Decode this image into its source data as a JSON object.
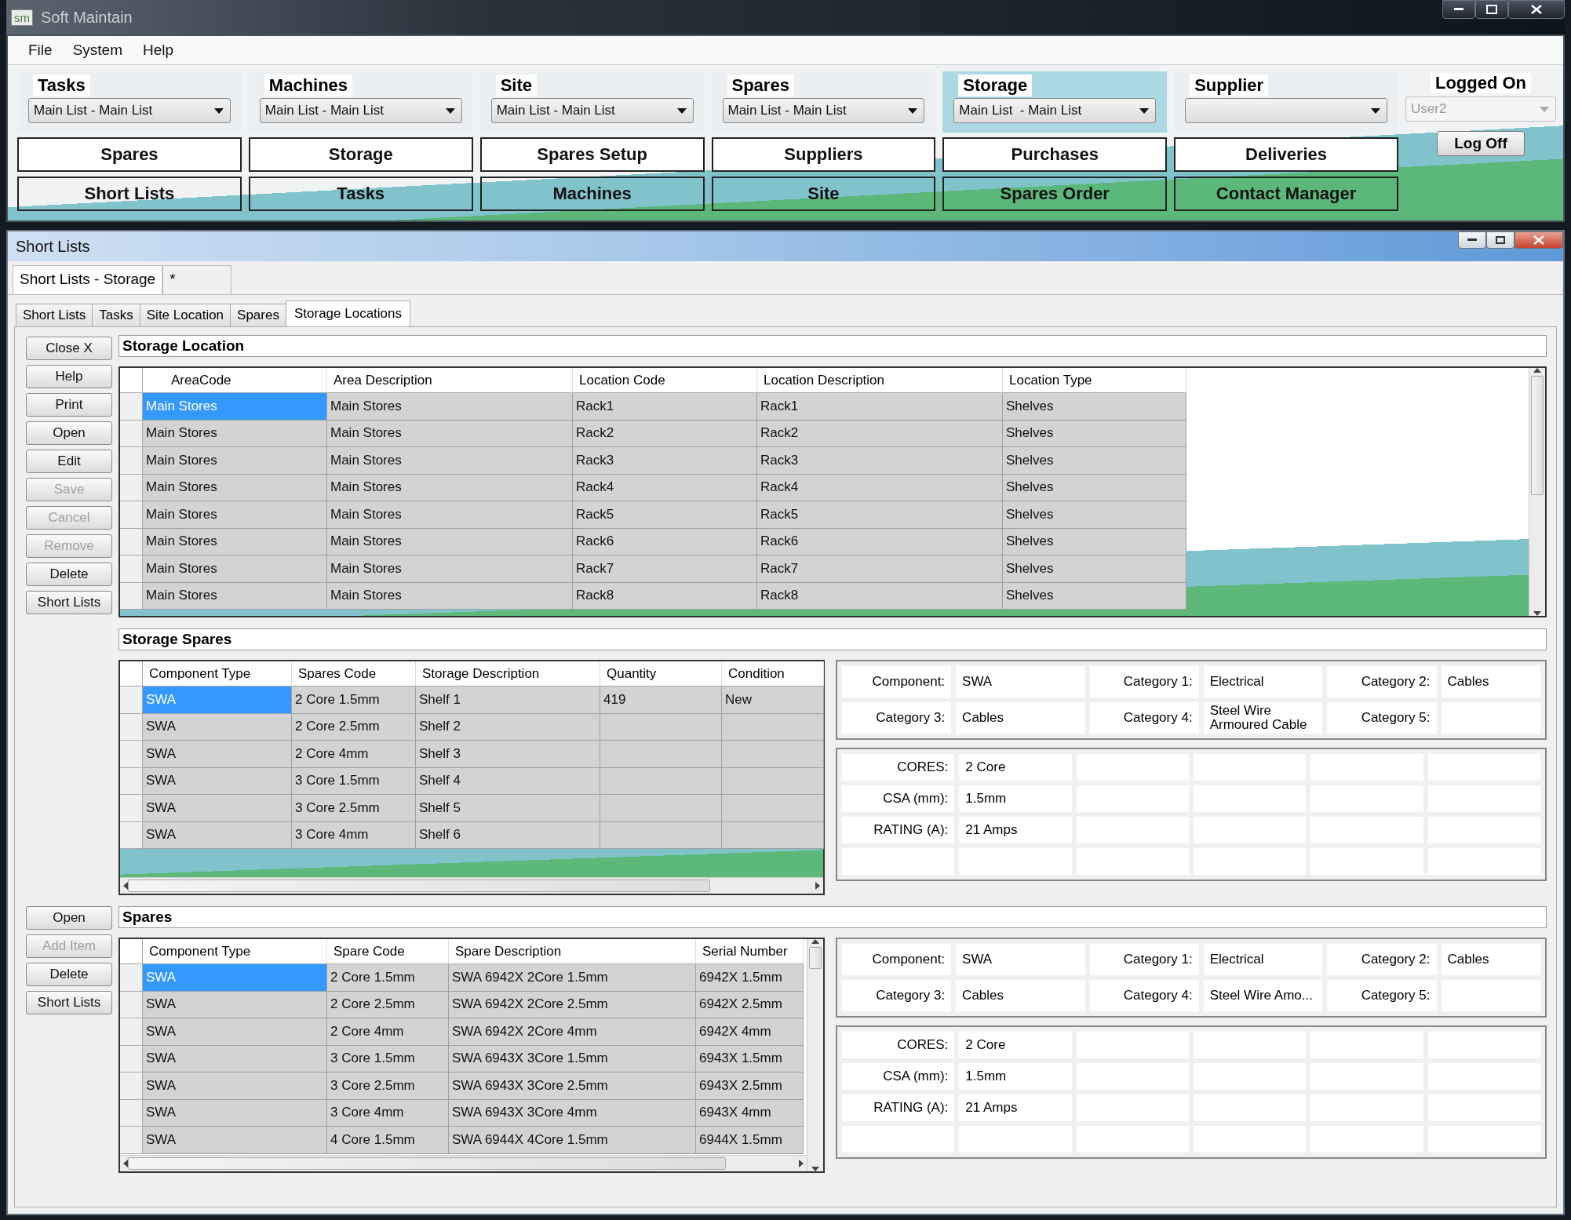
{
  "window": {
    "title": "Soft Maintain",
    "logo": "sm"
  },
  "menu": [
    "File",
    "System",
    "Help"
  ],
  "selectors": [
    {
      "label": "Tasks",
      "value": "Main List - Main List",
      "selected": false
    },
    {
      "label": "Machines",
      "value": "Main List - Main List",
      "selected": false
    },
    {
      "label": "Site",
      "value": "Main List - Main List",
      "selected": false
    },
    {
      "label": "Spares",
      "value": "Main List - Main List",
      "selected": false
    },
    {
      "label": "Storage",
      "value": "Main List  - Main List",
      "selected": true
    },
    {
      "label": "Supplier",
      "selected": false
    }
  ],
  "login": {
    "label": "Logged On",
    "user": "User2",
    "button": "Log Off"
  },
  "nav_rows": [
    [
      "Spares",
      "Storage",
      "Spares Setup",
      "Suppliers",
      "Purchases",
      "Deliveries"
    ],
    [
      "Short Lists",
      "Tasks",
      "Machines",
      "Site",
      "Spares Order",
      "Contact Manager"
    ]
  ],
  "child_window": {
    "title": "Short Lists"
  },
  "doc_tabs": [
    {
      "label": "Short Lists - Storage",
      "selected": true
    },
    {
      "label": "*",
      "selected": false
    }
  ],
  "tabs": [
    {
      "label": "Short Lists",
      "selected": false
    },
    {
      "label": "Tasks",
      "selected": false
    },
    {
      "label": "Site Location",
      "selected": false
    },
    {
      "label": "Spares",
      "selected": false
    },
    {
      "label": "Storage Locations",
      "selected": true
    }
  ],
  "side_buttons": [
    {
      "label": "Close X",
      "disabled": false
    },
    {
      "label": "Help",
      "disabled": false
    },
    {
      "label": "Print",
      "disabled": false
    },
    {
      "label": "Open",
      "disabled": false
    },
    {
      "label": "Edit",
      "disabled": false
    },
    {
      "label": "Save",
      "disabled": true
    },
    {
      "label": "Cancel",
      "disabled": true
    },
    {
      "label": "Remove",
      "disabled": true
    },
    {
      "label": "Delete",
      "disabled": false
    },
    {
      "label": "Short Lists",
      "disabled": false
    }
  ],
  "storage_location": {
    "title": "Storage Location",
    "columns": [
      "AreaCode",
      "Area Description",
      "Location Code",
      "Location Description",
      "Location Type"
    ],
    "rows": [
      {
        "cells": [
          "Main Stores",
          "Main Stores",
          "Rack1",
          "Rack1",
          "Shelves"
        ],
        "selected": true
      },
      {
        "cells": [
          "Main Stores",
          "Main Stores",
          "Rack2",
          "Rack2",
          "Shelves"
        ],
        "selected": false
      },
      {
        "cells": [
          "Main Stores",
          "Main Stores",
          "Rack3",
          "Rack3",
          "Shelves"
        ],
        "selected": false
      },
      {
        "cells": [
          "Main Stores",
          "Main Stores",
          "Rack4",
          "Rack4",
          "Shelves"
        ],
        "selected": false
      },
      {
        "cells": [
          "Main Stores",
          "Main Stores",
          "Rack5",
          "Rack5",
          "Shelves"
        ],
        "selected": false
      },
      {
        "cells": [
          "Main Stores",
          "Main Stores",
          "Rack6",
          "Rack6",
          "Shelves"
        ],
        "selected": false
      },
      {
        "cells": [
          "Main Stores",
          "Main Stores",
          "Rack7",
          "Rack7",
          "Shelves"
        ],
        "selected": false
      },
      {
        "cells": [
          "Main Stores",
          "Main Stores",
          "Rack8",
          "Rack8",
          "Shelves"
        ],
        "selected": false
      }
    ]
  },
  "storage_spares": {
    "title": "Storage Spares",
    "columns": [
      "Component Type",
      "Spares Code",
      "Storage Description",
      "Quantity",
      "Condition"
    ],
    "rows": [
      {
        "cells": [
          "SWA",
          "2 Core 1.5mm",
          "Shelf 1",
          "419",
          "New"
        ],
        "selected": true
      },
      {
        "cells": [
          "SWA",
          "2 Core 2.5mm",
          "Shelf 2",
          "",
          ""
        ],
        "selected": false
      },
      {
        "cells": [
          "SWA",
          "2 Core 4mm",
          "Shelf 3",
          "",
          ""
        ],
        "selected": false
      },
      {
        "cells": [
          "SWA",
          "3 Core 1.5mm",
          "Shelf 4",
          "",
          ""
        ],
        "selected": false
      },
      {
        "cells": [
          "SWA",
          "3 Core 2.5mm",
          "Shelf 5",
          "",
          ""
        ],
        "selected": false
      },
      {
        "cells": [
          "SWA",
          "3 Core 4mm",
          "Shelf 6",
          "",
          ""
        ],
        "selected": false
      }
    ],
    "details": [
      {
        "label": "Component:",
        "value": "SWA"
      },
      {
        "label": "Category 1:",
        "value": "Electrical"
      },
      {
        "label": "Category 2:",
        "value": "Cables"
      },
      {
        "label": "Category 3:",
        "value": "Cables"
      },
      {
        "label": "Category 4:",
        "value": "Steel Wire Armoured Cable"
      },
      {
        "label": "Category 5:"
      }
    ],
    "specs": [
      {
        "label": "CORES:",
        "value": "2 Core"
      },
      {
        "label": "CSA (mm):",
        "value": "1.5mm"
      },
      {
        "label": "RATING (A):",
        "value": "21 Amps"
      }
    ]
  },
  "spares_buttons": [
    {
      "label": "Open",
      "disabled": false
    },
    {
      "label": "Add Item",
      "disabled": true
    },
    {
      "label": "Delete",
      "disabled": false
    },
    {
      "label": "Short Lists",
      "disabled": false
    }
  ],
  "spares": {
    "title": "Spares",
    "columns": [
      "Component Type",
      "Spare Code",
      "Spare Description",
      "Serial Number"
    ],
    "rows": [
      {
        "cells": [
          "SWA",
          "2 Core 1.5mm",
          "SWA 6942X 2Core 1.5mm",
          "6942X 1.5mm"
        ],
        "selected": true
      },
      {
        "cells": [
          "SWA",
          "2 Core 2.5mm",
          "SWA 6942X 2Core 2.5mm",
          "6942X 2.5mm"
        ],
        "selected": false
      },
      {
        "cells": [
          "SWA",
          "2 Core 4mm",
          "SWA 6942X 2Core 4mm",
          "6942X 4mm"
        ],
        "selected": false
      },
      {
        "cells": [
          "SWA",
          "3 Core 1.5mm",
          "SWA 6943X 3Core 1.5mm",
          "6943X 1.5mm"
        ],
        "selected": false
      },
      {
        "cells": [
          "SWA",
          "3 Core 2.5mm",
          "SWA 6943X 3Core 2.5mm",
          "6943X 2.5mm"
        ],
        "selected": false
      },
      {
        "cells": [
          "SWA",
          "3 Core 4mm",
          "SWA 6943X 3Core 4mm",
          "6943X 4mm"
        ],
        "selected": false
      },
      {
        "cells": [
          "SWA",
          "4 Core 1.5mm",
          "SWA 6944X 4Core 1.5mm",
          "6944X 1.5mm"
        ],
        "selected": false
      }
    ],
    "details": [
      {
        "label": "Component:",
        "value": "SWA"
      },
      {
        "label": "Category 1:",
        "value": "Electrical"
      },
      {
        "label": "Category 2:",
        "value": "Cables"
      },
      {
        "label": "Category 3:",
        "value": "Cables"
      },
      {
        "label": "Category 4:",
        "value": "Steel Wire Amo..."
      },
      {
        "label": "Category 5:"
      }
    ],
    "specs": [
      {
        "label": "CORES:",
        "value": "2 Core"
      },
      {
        "label": "CSA (mm):",
        "value": "1.5mm"
      },
      {
        "label": "RATING (A):",
        "value": "21 Amps"
      }
    ]
  }
}
